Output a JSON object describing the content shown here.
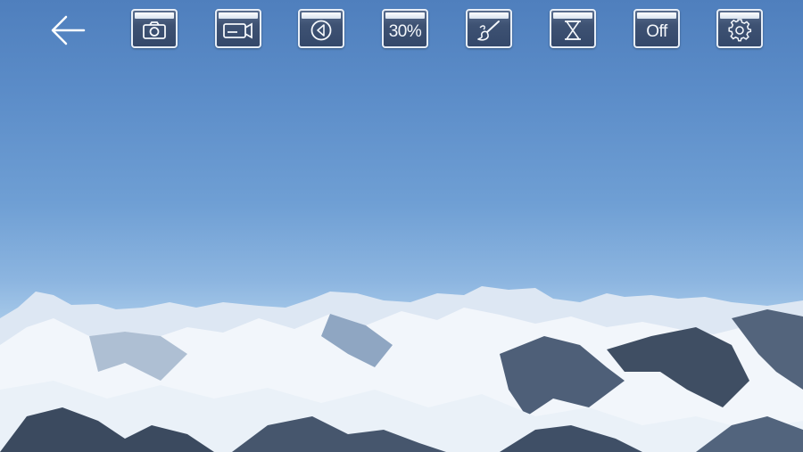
{
  "toolbar": {
    "back": {
      "icon": "arrow-left-icon"
    },
    "snapshot": {
      "icon": "camera-icon"
    },
    "record": {
      "icon": "video-camera-icon"
    },
    "playback": {
      "icon": "play-back-icon"
    },
    "quality": {
      "label": "30%"
    },
    "brush": {
      "icon": "brush-icon"
    },
    "timer": {
      "icon": "hourglass-icon"
    },
    "toggle": {
      "label": "Off"
    },
    "settings": {
      "icon": "gear-icon"
    }
  },
  "colors": {
    "button_fill": "#3e5273",
    "button_border": "#e7eef7",
    "icon": "#f4f7fb"
  }
}
